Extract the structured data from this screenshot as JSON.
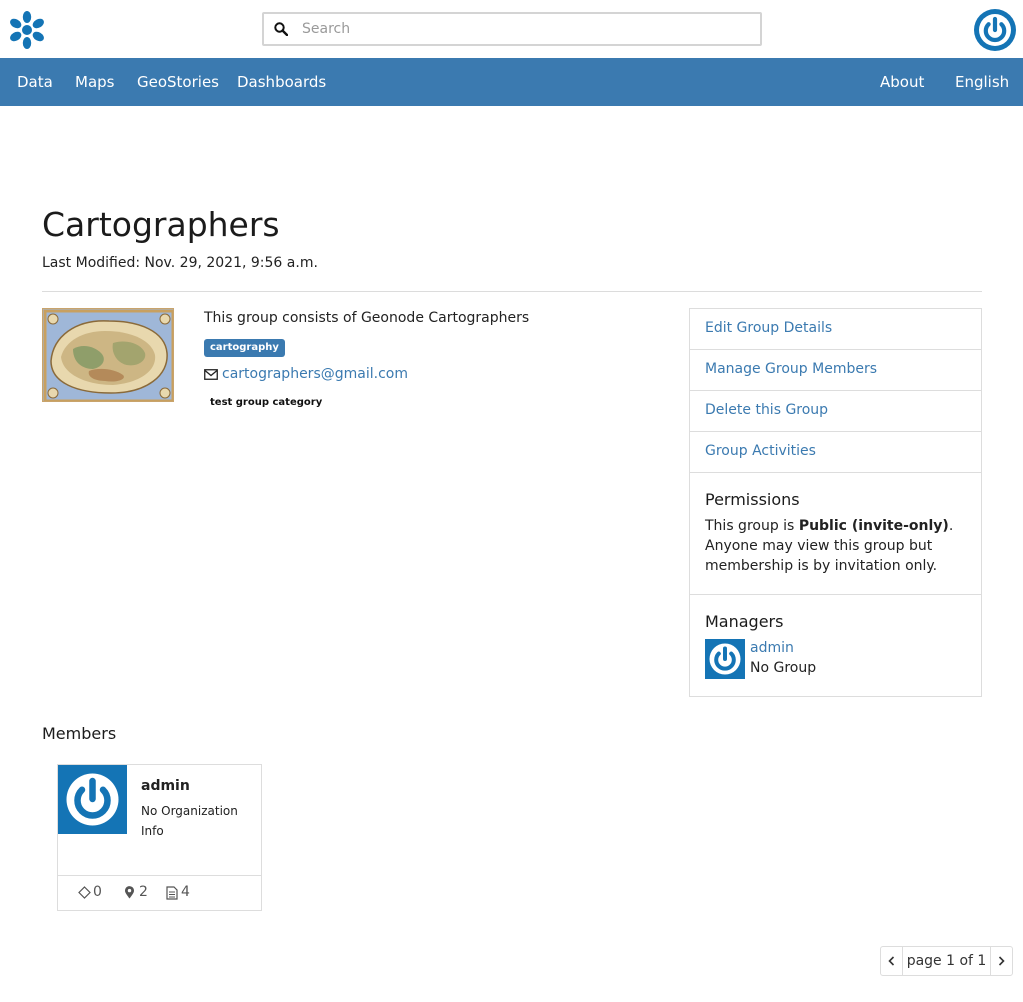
{
  "colors": {
    "brand": "#3b7ab0",
    "avatar_blue": "#1474b5"
  },
  "header": {
    "logo_icon": "geonode-logo-icon",
    "search": {
      "placeholder": "Search",
      "value": ""
    },
    "user_icon": "power-icon"
  },
  "nav": {
    "left": [
      {
        "label": "Data"
      },
      {
        "label": "Maps"
      },
      {
        "label": "GeoStories"
      },
      {
        "label": "Dashboards"
      }
    ],
    "right": [
      {
        "label": "About"
      },
      {
        "label": "English"
      }
    ]
  },
  "group": {
    "title": "Cartographers",
    "last_modified": "Last Modified: Nov. 29, 2021, 9:56 a.m.",
    "description": "This group consists of Geonode Cartographers",
    "keyword": "cartography",
    "email": "cartographers@gmail.com",
    "category": "test group category"
  },
  "sidebar": {
    "links": [
      {
        "label": "Edit Group Details"
      },
      {
        "label": "Manage Group Members"
      },
      {
        "label": "Delete this Group"
      },
      {
        "label": "Group Activities"
      }
    ],
    "permissions": {
      "title": "Permissions",
      "text_before": "This group is ",
      "text_bold": "Public (invite-only)",
      "text_after": ". Anyone may view this group but membership is by invitation only."
    },
    "managers": {
      "title": "Managers",
      "items": [
        {
          "name": "admin",
          "group": "No Group"
        }
      ]
    }
  },
  "members": {
    "title": "Members",
    "items": [
      {
        "name": "admin",
        "org": "No Organization Info",
        "stats": {
          "datasets": "0",
          "maps": "2",
          "documents": "4"
        }
      }
    ]
  },
  "pagination": {
    "label": "page 1 of 1"
  }
}
